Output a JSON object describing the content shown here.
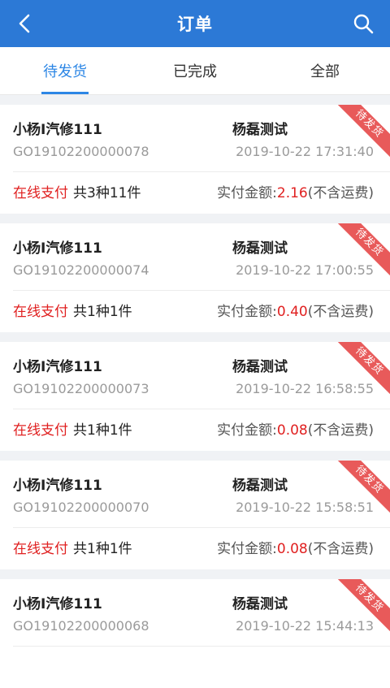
{
  "header": {
    "title": "订单",
    "back_icon": "chevron-left-icon",
    "search_icon": "search-icon"
  },
  "tabs": [
    {
      "label": "待发货",
      "active": true
    },
    {
      "label": "已完成",
      "active": false
    },
    {
      "label": "全部",
      "active": false
    }
  ],
  "orders": [
    {
      "shop": "小杨I汽修111",
      "buyer": "杨磊测试",
      "order_no": "GO19102200000078",
      "time": "2019-10-22 17:31:40",
      "pay_method": "在线支付",
      "qty": "共3种11件",
      "amount_label": "实付金额:",
      "amount": "2.16",
      "note": "(不含运费)",
      "status": "待发货"
    },
    {
      "shop": "小杨I汽修111",
      "buyer": "杨磊测试",
      "order_no": "GO19102200000074",
      "time": "2019-10-22 17:00:55",
      "pay_method": "在线支付",
      "qty": "共1种1件",
      "amount_label": "实付金额:",
      "amount": "0.40",
      "note": "(不含运费)",
      "status": "待发货"
    },
    {
      "shop": "小杨I汽修111",
      "buyer": "杨磊测试",
      "order_no": "GO19102200000073",
      "time": "2019-10-22 16:58:55",
      "pay_method": "在线支付",
      "qty": "共1种1件",
      "amount_label": "实付金额:",
      "amount": "0.08",
      "note": "(不含运费)",
      "status": "待发货"
    },
    {
      "shop": "小杨I汽修111",
      "buyer": "杨磊测试",
      "order_no": "GO19102200000070",
      "time": "2019-10-22 15:58:51",
      "pay_method": "在线支付",
      "qty": "共1种1件",
      "amount_label": "实付金额:",
      "amount": "0.08",
      "note": "(不含运费)",
      "status": "待发货"
    },
    {
      "shop": "小杨I汽修111",
      "buyer": "杨磊测试",
      "order_no": "GO19102200000068",
      "time": "2019-10-22 15:44:13",
      "pay_method": "",
      "qty": "",
      "amount_label": "",
      "amount": "",
      "note": "",
      "status": "待发货"
    }
  ],
  "colors": {
    "primary": "#2c79d6",
    "tab_active": "#2c86e5",
    "price": "#e02020",
    "ribbon": "#e85a5a"
  }
}
